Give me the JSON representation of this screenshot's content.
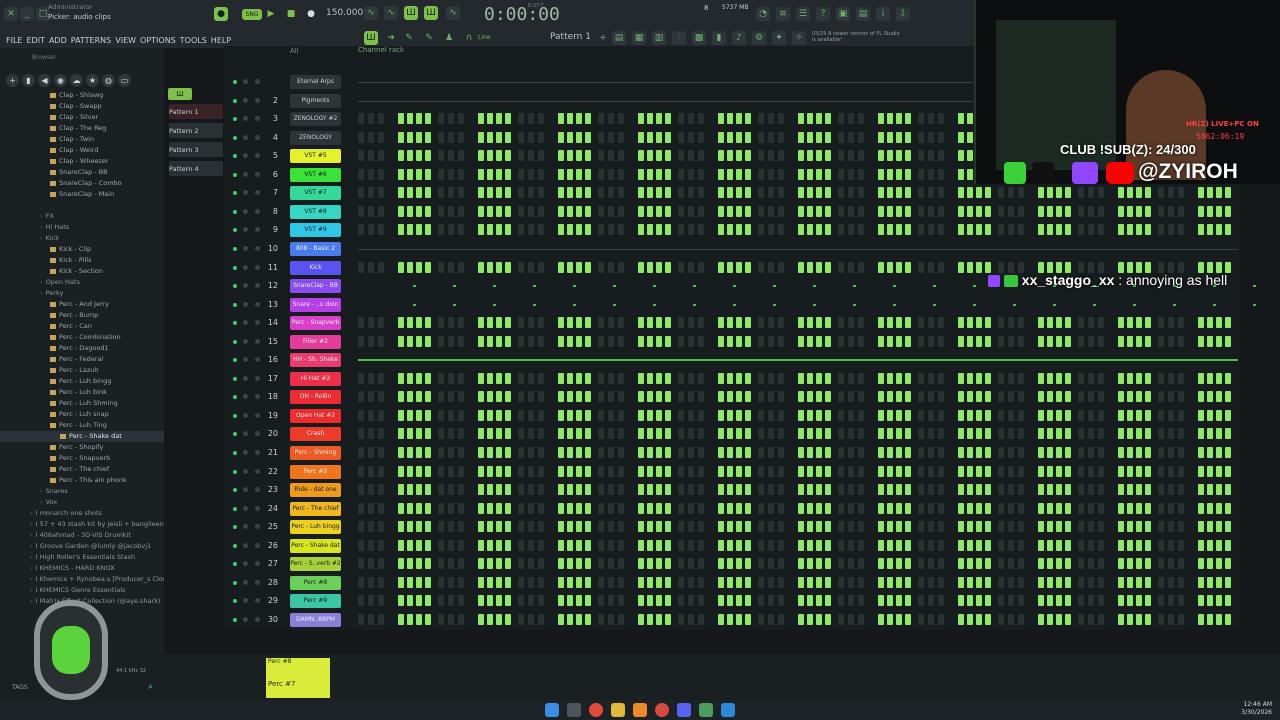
{
  "title": {
    "user": "Administrator",
    "picker": "Picker: audio clips"
  },
  "menu": [
    "FILE",
    "EDIT",
    "ADD",
    "PATTERNS",
    "VIEW",
    "OPTIONS",
    "TOOLS",
    "HELP"
  ],
  "transport": {
    "tempo": "150.000",
    "time": "0:00:00",
    "mem": "5737 MB",
    "cpu": "8",
    "bar": "B:ST:T"
  },
  "toolbar": {
    "pattern": "Pattern 1",
    "tool_mode": "Line",
    "news": "03/25  A newer version of FL Studio is available!"
  },
  "browser": {
    "title": "Browser",
    "items": [
      {
        "label": "Clap - Shlawg",
        "type": "file",
        "indent": 5
      },
      {
        "label": "Clap - Swapp",
        "type": "file",
        "indent": 5
      },
      {
        "label": "Clap - Silver",
        "type": "file",
        "indent": 5
      },
      {
        "label": "Clap - The Reg",
        "type": "file",
        "indent": 5
      },
      {
        "label": "Clap - Twin",
        "type": "file",
        "indent": 5
      },
      {
        "label": "Clap - Weird",
        "type": "file",
        "indent": 5
      },
      {
        "label": "Clap - Wheezer",
        "type": "file",
        "indent": 5
      },
      {
        "label": "SnareClap - BB",
        "type": "file",
        "indent": 5
      },
      {
        "label": "SnareClap - Combo",
        "type": "file",
        "indent": 5
      },
      {
        "label": "SnareClap - Main",
        "type": "file",
        "indent": 5
      },
      {
        "label": "",
        "type": "gap",
        "indent": 0
      },
      {
        "label": "FX",
        "type": "folder",
        "indent": 4
      },
      {
        "label": "Hi Hats",
        "type": "folder",
        "indent": 4
      },
      {
        "label": "Kick",
        "type": "folder",
        "indent": 4
      },
      {
        "label": "Kick - Clip",
        "type": "file",
        "indent": 5
      },
      {
        "label": "Kick - Pills",
        "type": "file",
        "indent": 5
      },
      {
        "label": "Kick - Section",
        "type": "file",
        "indent": 5
      },
      {
        "label": "Open Hats",
        "type": "folder",
        "indent": 4
      },
      {
        "label": "Perky",
        "type": "folder",
        "indent": 4
      },
      {
        "label": "Perc - And Jerry",
        "type": "file",
        "indent": 5
      },
      {
        "label": "Perc - Bump",
        "type": "file",
        "indent": 5
      },
      {
        "label": "Perc - Can",
        "type": "file",
        "indent": 5
      },
      {
        "label": "Perc - Combination",
        "type": "file",
        "indent": 5
      },
      {
        "label": "Perc - Dagood1",
        "type": "file",
        "indent": 5
      },
      {
        "label": "Perc - Federal",
        "type": "file",
        "indent": 5
      },
      {
        "label": "Perc - Lazuh",
        "type": "file",
        "indent": 5
      },
      {
        "label": "Perc - Luh bingg",
        "type": "file",
        "indent": 5
      },
      {
        "label": "Perc - Luh bink",
        "type": "file",
        "indent": 5
      },
      {
        "label": "Perc - Luh Shming",
        "type": "file",
        "indent": 5
      },
      {
        "label": "Perc - Luh snap",
        "type": "file",
        "indent": 5
      },
      {
        "label": "Perc - Luh Ting",
        "type": "file",
        "indent": 5
      },
      {
        "label": "Perc - Shake dat",
        "type": "file",
        "indent": 6,
        "selected": true
      },
      {
        "label": "Perc - Shopify",
        "type": "file",
        "indent": 5
      },
      {
        "label": "Perc - Snapverb",
        "type": "file",
        "indent": 5
      },
      {
        "label": "Perc - The chief",
        "type": "file",
        "indent": 5
      },
      {
        "label": "Perc - This ain phonk",
        "type": "file",
        "indent": 5
      },
      {
        "label": "Snares",
        "type": "folder",
        "indent": 4
      },
      {
        "label": "Vox",
        "type": "folder",
        "indent": 4
      },
      {
        "label": "I monarch one shots",
        "type": "folder",
        "indent": 3
      },
      {
        "label": "I 57 + 43 stash kit by jeisli + bangileen",
        "type": "folder",
        "indent": 3
      },
      {
        "label": "I 406ahmad - 3D-VIS Drumkit",
        "type": "folder",
        "indent": 3
      },
      {
        "label": "I Groove Garden @lumly @jacobvj1",
        "type": "folder",
        "indent": 3
      },
      {
        "label": "I High Roller's Essentials Stash",
        "type": "folder",
        "indent": 3
      },
      {
        "label": "I KHEMICS - HARD KNOX",
        "type": "folder",
        "indent": 3
      },
      {
        "label": "I Khemics + Rynobea.s [Producer_s Cloud]",
        "type": "folder",
        "indent": 3
      },
      {
        "label": "I KHEMICS Genre Essentials",
        "type": "folder",
        "indent": 3
      },
      {
        "label": "I Matrix Effect Collection (@aye.shark)",
        "type": "folder",
        "indent": 3
      }
    ]
  },
  "patterns": [
    "Pattern 1",
    "Pattern 2",
    "Pattern 3",
    "Pattern 4"
  ],
  "rack": {
    "title": "Channel rack",
    "filter": "All",
    "channels": [
      {
        "num": "",
        "name": "Eternal Arps",
        "color": "#2d3539",
        "text": "#c8d0d4",
        "mode": "lane"
      },
      {
        "num": "2",
        "name": "Pigments",
        "color": "#2d3539",
        "text": "#c8d0d4",
        "mode": "lane"
      },
      {
        "num": "3",
        "name": "ZENOLOGY #2",
        "color": "#2d3539",
        "text": "#c8d0d4",
        "mode": "steps"
      },
      {
        "num": "4",
        "name": "ZENOLOGY",
        "color": "#2d3539",
        "text": "#c8d0d4",
        "mode": "steps"
      },
      {
        "num": "5",
        "name": "VST #5",
        "color": "#e3f22a",
        "text": "#1a1d1f",
        "mode": "steps"
      },
      {
        "num": "6",
        "name": "VST #6",
        "color": "#3ae23a",
        "text": "#1a1d1f",
        "mode": "steps"
      },
      {
        "num": "7",
        "name": "VST #7",
        "color": "#34d99a",
        "text": "#1a1d1f",
        "mode": "steps"
      },
      {
        "num": "8",
        "name": "VST #8",
        "color": "#35d6c4",
        "text": "#1a1d1f",
        "mode": "steps"
      },
      {
        "num": "9",
        "name": "VST #9",
        "color": "#2ec8e6",
        "text": "#1a1d1f",
        "mode": "steps"
      },
      {
        "num": "10",
        "name": "808 - Basic 2",
        "color": "#4c7bf0",
        "text": "#e8eef0",
        "mode": "lane"
      },
      {
        "num": "11",
        "name": "Kick",
        "color": "#5a53f2",
        "text": "#e8eef0",
        "mode": "steps"
      },
      {
        "num": "12",
        "name": "SnareClap - BB",
        "color": "#8a4cf0",
        "text": "#e8eef0",
        "mode": "dots"
      },
      {
        "num": "13",
        "name": "Snare - ..u doin",
        "color": "#b63fe8",
        "text": "#e8eef0",
        "mode": "dots"
      },
      {
        "num": "14",
        "name": "Perc - Snapverb",
        "color": "#d93fc8",
        "text": "#e8eef0",
        "mode": "steps"
      },
      {
        "num": "15",
        "name": "Filler #2",
        "color": "#e53c9a",
        "text": "#e8eef0",
        "mode": "steps"
      },
      {
        "num": "16",
        "name": "HH - Sh. Shake",
        "color": "#ea3a6e",
        "text": "#e8eef0",
        "mode": "line"
      },
      {
        "num": "17",
        "name": "Hi Hat #2",
        "color": "#ed2f4a",
        "text": "#e8eef0",
        "mode": "steps"
      },
      {
        "num": "18",
        "name": "OH - Rollin",
        "color": "#ee2a33",
        "text": "#e8eef0",
        "mode": "steps"
      },
      {
        "num": "19",
        "name": "Open Hat #2",
        "color": "#ee2a2a",
        "text": "#e8eef0",
        "mode": "steps"
      },
      {
        "num": "20",
        "name": "Crash",
        "color": "#ee3a28",
        "text": "#e8eef0",
        "mode": "steps"
      },
      {
        "num": "21",
        "name": "Perc - Shming",
        "color": "#ef5a22",
        "text": "#e8eef0",
        "mode": "steps"
      },
      {
        "num": "22",
        "name": "Perc #2",
        "color": "#f0761e",
        "text": "#e8eef0",
        "mode": "steps"
      },
      {
        "num": "23",
        "name": "Ride - dat one",
        "color": "#f09a1c",
        "text": "#1a1d1f",
        "mode": "steps"
      },
      {
        "num": "24",
        "name": "Perc - The chief",
        "color": "#f0b81c",
        "text": "#1a1d1f",
        "mode": "steps"
      },
      {
        "num": "25",
        "name": "Perc - Luh bingg",
        "color": "#ecd21c",
        "text": "#1a1d1f",
        "mode": "steps"
      },
      {
        "num": "26",
        "name": "Perc - Shake dat",
        "color": "#d8e41c",
        "text": "#1a1d1f",
        "mode": "steps"
      },
      {
        "num": "27",
        "name": "Perc - S..verb #2",
        "color": "#a8d23a",
        "text": "#1a1d1f",
        "mode": "steps"
      },
      {
        "num": "28",
        "name": "Perc #8",
        "color": "#6ccf5a",
        "text": "#1a1d1f",
        "mode": "steps"
      },
      {
        "num": "29",
        "name": "Perc #9",
        "color": "#3ac6a0",
        "text": "#1a1d1f",
        "mode": "steps"
      },
      {
        "num": "30",
        "name": "DAMN..8BPM",
        "color": "#8a7fd6",
        "text": "#e8eef0",
        "mode": "steps"
      }
    ]
  },
  "bottom": {
    "clip_label": "Perc #7",
    "clip_top": "Perc #8",
    "tags_label": "TAGS",
    "rate": "44.1 kHz 32"
  },
  "stream": {
    "sub_goal": "CLUB !SUB(Z): 24/300",
    "handle": "@ZYIROH",
    "live_tag": "HR(Z) LIVE+PC ON",
    "timer": "5862:06:19",
    "chat_user": "xx_staggo_xx",
    "chat_message": ": annoying as hell"
  },
  "clock": {
    "time": "12:46 AM",
    "date": "3/30/2026"
  },
  "colors": {
    "step_on": "#8fe86a",
    "step_off": "#2a3034",
    "accent": "#7fc04a"
  }
}
